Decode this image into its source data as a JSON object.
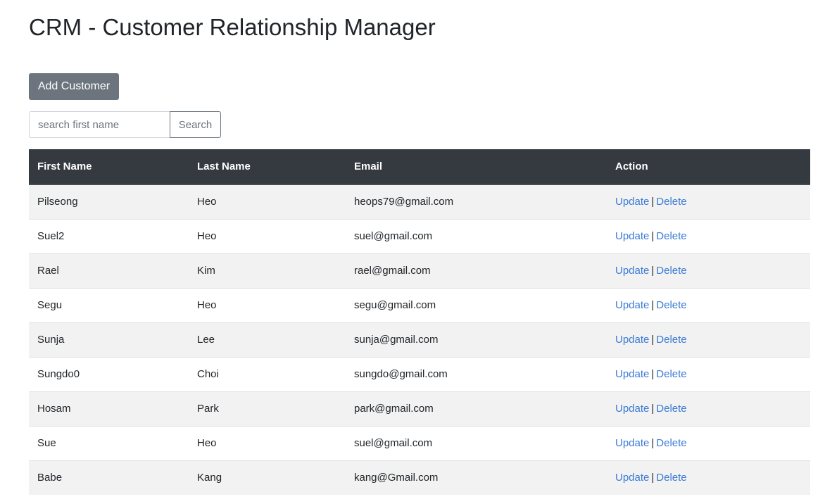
{
  "page": {
    "title": "CRM - Customer Relationship Manager"
  },
  "toolbar": {
    "add_label": "Add Customer"
  },
  "search": {
    "placeholder": "search first name",
    "value": "",
    "button_label": "Search"
  },
  "table": {
    "headers": [
      "First Name",
      "Last Name",
      "Email",
      "Action"
    ],
    "rows": [
      {
        "first": "Pilseong",
        "last": "Heo",
        "email": "heops79@gmail.com"
      },
      {
        "first": "Suel2",
        "last": "Heo",
        "email": "suel@gmail.com"
      },
      {
        "first": "Rael",
        "last": "Kim",
        "email": "rael@gmail.com"
      },
      {
        "first": "Segu",
        "last": "Heo",
        "email": "segu@gmail.com"
      },
      {
        "first": "Sunja",
        "last": "Lee",
        "email": "sunja@gmail.com"
      },
      {
        "first": "Sungdo0",
        "last": "Choi",
        "email": "sungdo@gmail.com"
      },
      {
        "first": "Hosam",
        "last": "Park",
        "email": "park@gmail.com"
      },
      {
        "first": "Sue",
        "last": "Heo",
        "email": "suel@gmail.com"
      },
      {
        "first": "Babe",
        "last": "Kang",
        "email": "kang@Gmail.com"
      }
    ],
    "update_label": "Update",
    "separator": "|",
    "delete_label": "Delete"
  },
  "colors": {
    "header_bg": "#343a40",
    "button_secondary": "#6c757d",
    "link": "#3a7bd5",
    "row_stripe": "#f2f2f2"
  }
}
